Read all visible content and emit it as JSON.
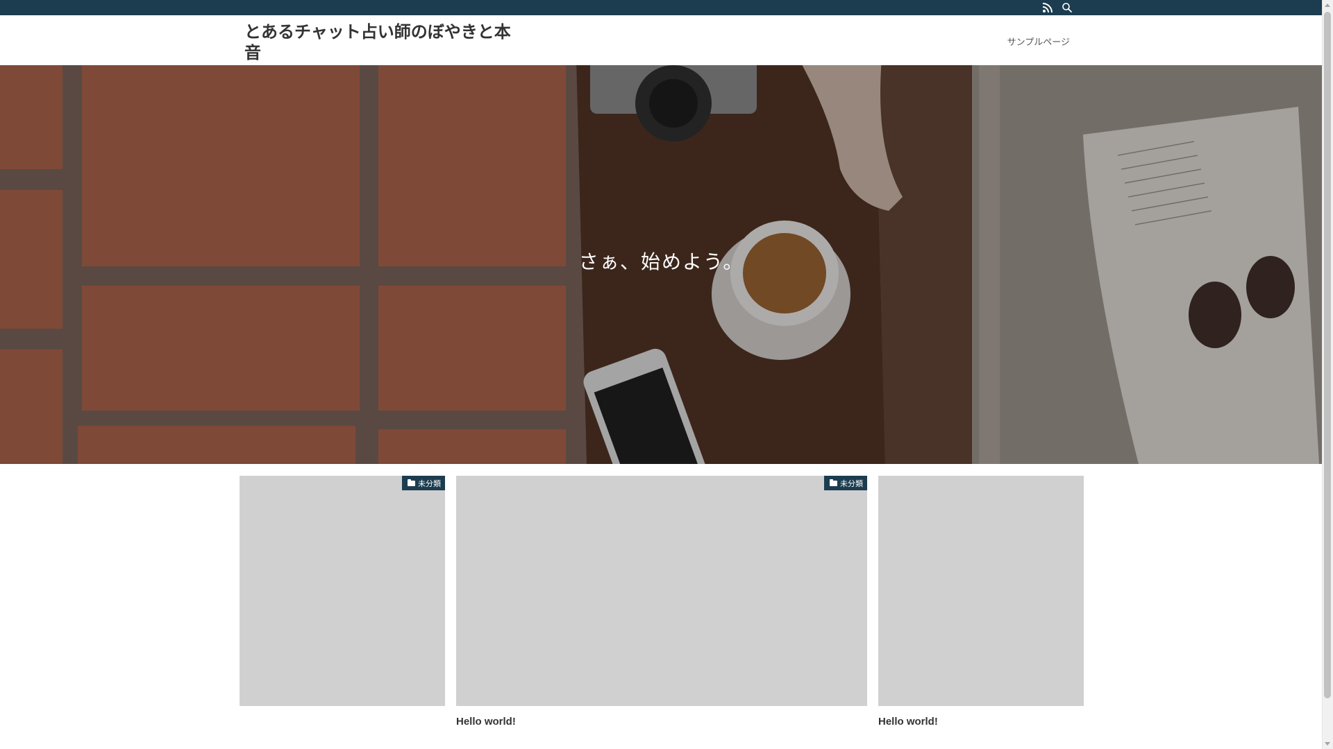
{
  "topbar": {
    "icons": [
      "rss-icon",
      "search-icon"
    ]
  },
  "header": {
    "site_title": "とあるチャット占い師のぼやきと本音",
    "nav": [
      {
        "label": "サンプルページ"
      }
    ]
  },
  "hero": {
    "catchphrase": "さぁ、始めよう。"
  },
  "posts": [
    {
      "category": "未分類",
      "title": ""
    },
    {
      "category": "未分類",
      "title": "Hello world!"
    },
    {
      "category": "",
      "title": "Hello world!"
    }
  ],
  "colors": {
    "topbar": "#1c3d4f",
    "badge": "#1c3d4f",
    "thumb_placeholder": "#d0d0d0"
  }
}
